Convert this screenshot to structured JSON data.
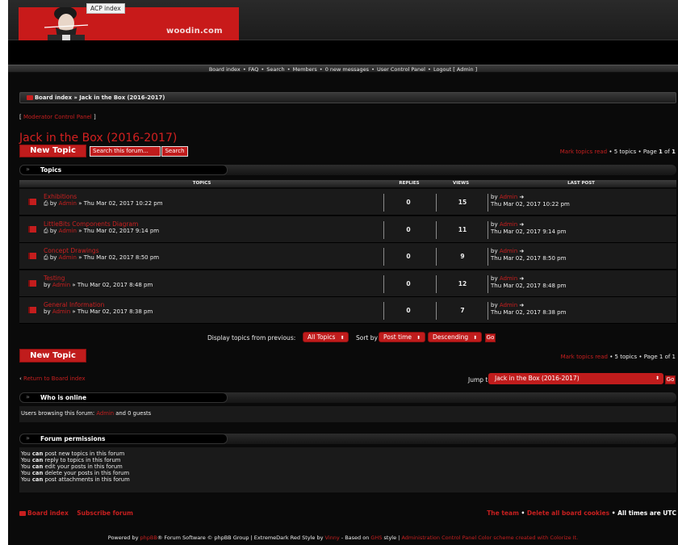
{
  "header": {
    "site_name": "woodin.com",
    "tooltip": "ACP index",
    "nav": [
      "Board index",
      "FAQ",
      "Search",
      "Members",
      "0 new messages",
      "User Control Panel",
      "Logout [ Admin ]"
    ]
  },
  "breadcrumb": {
    "home": "Board index",
    "sep": "»",
    "current": "Jack in the Box (2016-2017)"
  },
  "mcp": {
    "open": "[ ",
    "label": "Moderator Control Panel",
    "close": " ]"
  },
  "forum": {
    "title": "Jack in the Box (2016-2017)",
    "new_topic": "New Topic",
    "search_placeholder": "Search this forum...",
    "search_button": "Search",
    "mark_read": "Mark topics read",
    "topic_count": " • 5 topics • Page ",
    "page": "1",
    "page_of": " of ",
    "page_total": "1"
  },
  "topics_section": {
    "label": "Topics",
    "columns": [
      "TOPICS",
      "REPLIES",
      "VIEWS",
      "LAST POST"
    ],
    "rows": [
      {
        "title": "Exhibitions",
        "by": "by",
        "author": "Admin",
        "date": "» Thu Mar 02, 2017 10:22 pm",
        "attach": true,
        "replies": "0",
        "views": "15",
        "lp_by": "by",
        "lp_author": "Admin",
        "lp_date": "Thu Mar 02, 2017 10:22 pm"
      },
      {
        "title": "LittleBits Components Diagram",
        "by": "by",
        "author": "Admin",
        "date": "» Thu Mar 02, 2017 9:14 pm",
        "attach": true,
        "replies": "0",
        "views": "11",
        "lp_by": "by",
        "lp_author": "Admin",
        "lp_date": "Thu Mar 02, 2017 9:14 pm"
      },
      {
        "title": "Concept Drawings",
        "by": "by",
        "author": "Admin",
        "date": "» Thu Mar 02, 2017 8:50 pm",
        "attach": true,
        "replies": "0",
        "views": "9",
        "lp_by": "by",
        "lp_author": "Admin",
        "lp_date": "Thu Mar 02, 2017 8:50 pm"
      },
      {
        "title": "Testing",
        "by": "by",
        "author": "Admin",
        "date": "» Thu Mar 02, 2017 8:48 pm",
        "attach": false,
        "replies": "0",
        "views": "12",
        "lp_by": "by",
        "lp_author": "Admin",
        "lp_date": "Thu Mar 02, 2017 8:48 pm"
      },
      {
        "title": "General Information",
        "by": "by",
        "author": "Admin",
        "date": "» Thu Mar 02, 2017 8:38 pm",
        "attach": false,
        "replies": "0",
        "views": "7",
        "lp_by": "by",
        "lp_author": "Admin",
        "lp_date": "Thu Mar 02, 2017 8:38 pm"
      }
    ]
  },
  "display": {
    "label": "Display topics from previous:",
    "days_value": "All Topics",
    "sort_label": "Sort by",
    "sort_key": "Post time",
    "sort_dir": "Descending",
    "go": "Go"
  },
  "bottom": {
    "new_topic": "New Topic",
    "mark_read": "Mark topics read",
    "topic_count": " • 5 topics • Page 1 of 1",
    "return_arrow": "‹",
    "return": "Return to Board index",
    "jump_label": "Jump to:",
    "jump_value": "Jack in the Box (2016-2017)",
    "jump_go": "Go"
  },
  "who_online": {
    "label": "Who is online",
    "prefix": "Users browsing this forum: ",
    "user": "Admin",
    "suffix": " and 0 guests"
  },
  "permissions": {
    "label": "Forum permissions",
    "lines": [
      {
        "a": "You ",
        "b": "can",
        "c": " post new topics in this forum"
      },
      {
        "a": "You ",
        "b": "can",
        "c": " reply to topics in this forum"
      },
      {
        "a": "You ",
        "b": "can",
        "c": " edit your posts in this forum"
      },
      {
        "a": "You ",
        "b": "can",
        "c": " delete your posts in this forum"
      },
      {
        "a": "You ",
        "b": "can",
        "c": " post attachments in this forum"
      }
    ]
  },
  "footer": {
    "board_index": "Board index",
    "subscribe": "Subscribe forum",
    "team": "The team",
    "bullet": " • ",
    "delete_cookies": "Delete all board cookies",
    "timezone": "All times are UTC",
    "powered_by": "Powered by ",
    "phpbb": "phpBB",
    "powered_rest": "® Forum Software © phpBB Group | ExtremeDark Red Style by ",
    "vinny": "Vinny",
    "based_on": " - Based on ",
    "ghs": "GHS",
    "style": " style | ",
    "acp": "Administration Control Panel",
    "colorscheme": " Color scheme created with Colorize It."
  },
  "colors": {
    "accent": "#c81f1f",
    "background": "#0a0a0a",
    "row": "#1a1a1a"
  }
}
